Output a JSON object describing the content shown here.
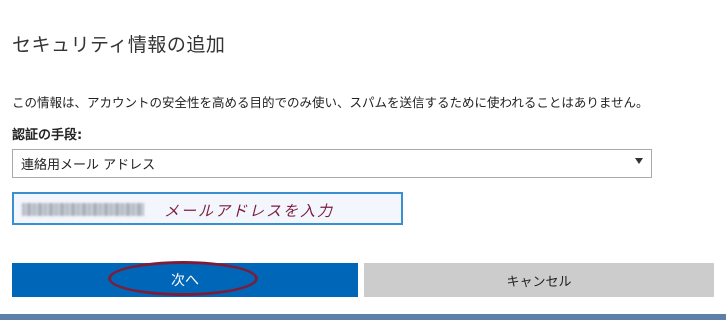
{
  "dialog": {
    "title": "セキュリティ情報の追加",
    "info_text": "この情報は、アカウントの安全性を高める目的でのみ使い、スパムを送信するために使われることはありません。",
    "method_label": "認証の手段:",
    "method_select": {
      "selected": "連絡用メール アドレス"
    },
    "email_input": {
      "annotation": "メールアドレスを入力"
    },
    "buttons": {
      "next": "次へ",
      "cancel": "キャンセル"
    }
  },
  "colors": {
    "primary_button": "#0067b8",
    "cancel_button": "#cccccc",
    "input_border": "#3a8fd0",
    "annotation": "#7a1e3c",
    "bottom_bar": "#5e7fa6"
  }
}
